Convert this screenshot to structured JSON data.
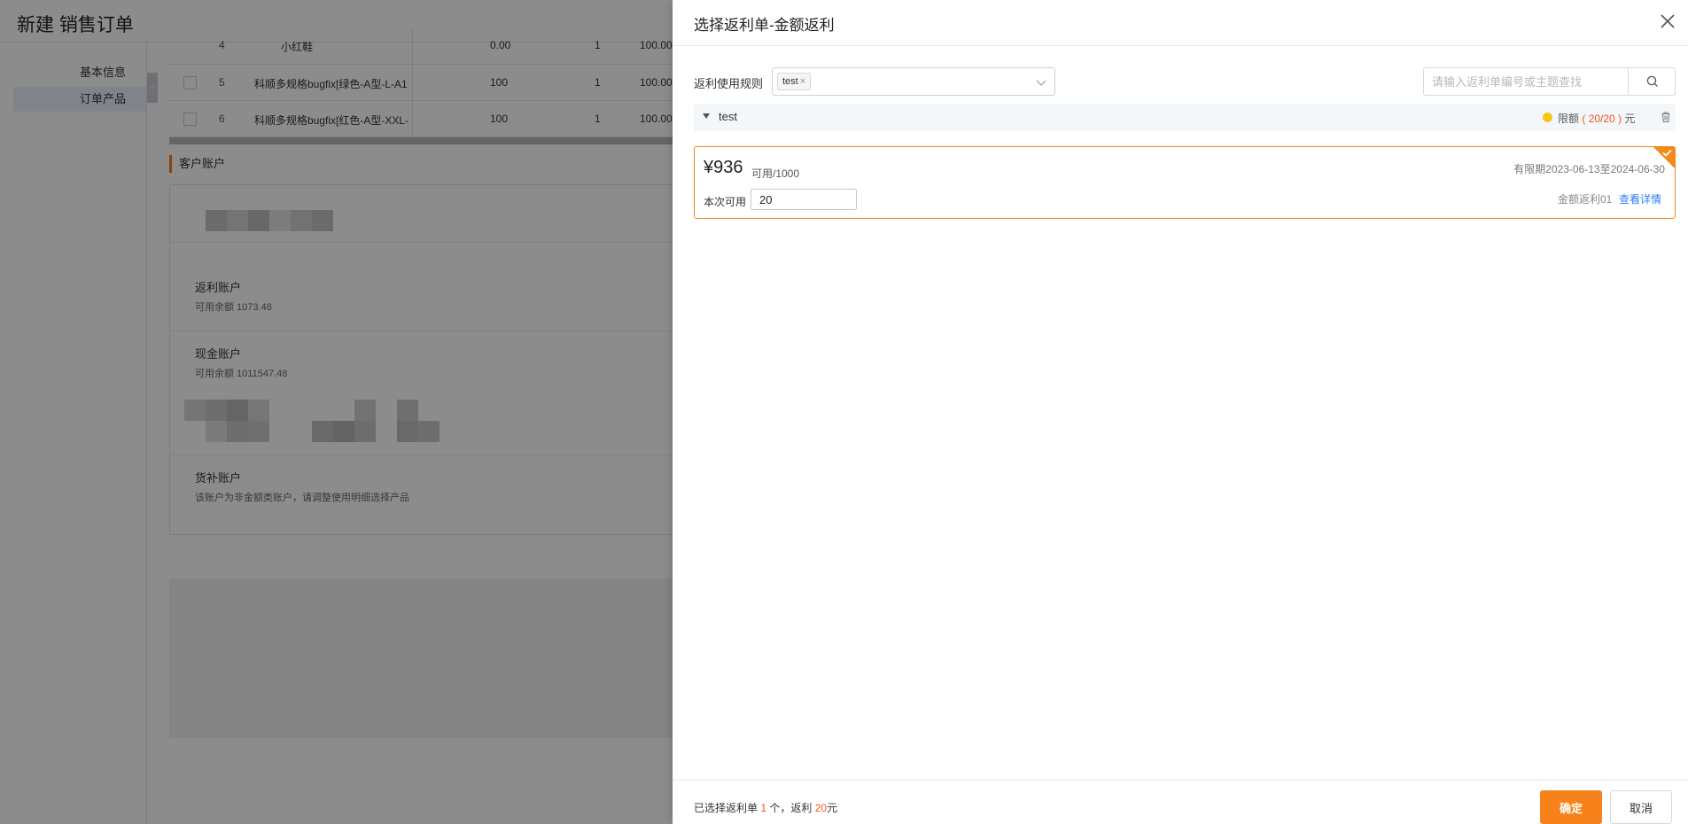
{
  "page": {
    "title": "新建 销售订单",
    "nav": [
      "基本信息",
      "订单产品"
    ],
    "products": [
      {
        "no": "4",
        "name": "小红鞋",
        "price": "0.00",
        "qty": "1",
        "total": "100.00"
      },
      {
        "no": "5",
        "name": "科顺多规格bugfix[绿色-A型-L-A1",
        "price": "100",
        "qty": "1",
        "total": "100.00"
      },
      {
        "no": "6",
        "name": "科顺多规格bugfix[红色-A型-XXL-",
        "price": "100",
        "qty": "1",
        "total": "100.00"
      }
    ],
    "customer_section_title": "客户账户",
    "accounts": [
      {
        "title": "返利账户",
        "subtitle": "可用余额 1073.48"
      },
      {
        "title": "现金账户",
        "subtitle": "可用余额 1011547.48"
      },
      {
        "title": "货补账户",
        "subtitle": "该账户为非金额类账户，请调整使用明细选择产品"
      }
    ]
  },
  "drawer": {
    "title": "选择返利单-金额返利",
    "rule_label": "返利使用规则",
    "rule_tag": "test",
    "rule_tag_remove": "×",
    "search_placeholder": "请输入返利单编号或主题查找",
    "group": {
      "name": "test",
      "limit_prefix": "限额",
      "limit_open": "(",
      "limit_value": "20/20",
      "limit_close": ")",
      "limit_unit": "元",
      "limit_status_color": "#f5c518"
    },
    "card": {
      "amount": "¥936",
      "available": "可用/1000",
      "validity": "有限期2023-06-13至2024-06-30",
      "use_label": "本次可用",
      "use_value": "20",
      "rebate_name": "金额返利01",
      "detail_link": "查看详情",
      "selected": true,
      "accent_color": "#f08a1e"
    },
    "footer": {
      "summary_prefix": "已选择返利单",
      "selected_count": "1",
      "summary_middle": "个，返利",
      "rebate_total": "20",
      "summary_suffix": "元",
      "confirm_label": "确定",
      "cancel_label": "取消",
      "confirm_color": "#f7821b"
    }
  }
}
